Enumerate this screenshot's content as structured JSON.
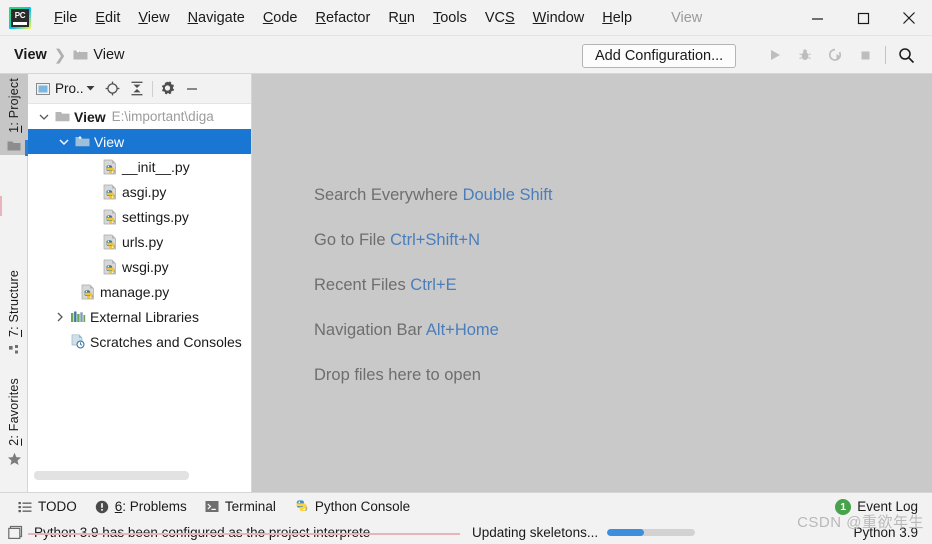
{
  "window": {
    "title": "View",
    "logo_text": "PC",
    "controls": [
      {
        "name": "minimize",
        "label": "—"
      },
      {
        "name": "maximize",
        "label": "□"
      },
      {
        "name": "close",
        "label": "✕"
      }
    ]
  },
  "menubar": {
    "items": [
      {
        "label": "File",
        "mnemonic": "F"
      },
      {
        "label": "Edit",
        "mnemonic": "E"
      },
      {
        "label": "View",
        "mnemonic": "V"
      },
      {
        "label": "Navigate",
        "mnemonic": "N"
      },
      {
        "label": "Code",
        "mnemonic": "C"
      },
      {
        "label": "Refactor",
        "mnemonic": "R"
      },
      {
        "label": "Run",
        "mnemonic": "u"
      },
      {
        "label": "Tools",
        "mnemonic": "T"
      },
      {
        "label": "VCS",
        "mnemonic": "S"
      },
      {
        "label": "Window",
        "mnemonic": "W"
      },
      {
        "label": "Help",
        "mnemonic": "H"
      }
    ]
  },
  "navbar": {
    "breadcrumb_root": "View",
    "breadcrumb_separator": "❯",
    "breadcrumb_leaf": "View",
    "folder_icon": "folder-icon",
    "add_configuration_label": "Add Configuration...",
    "toolbar_icons": [
      {
        "name": "run-icon",
        "enabled": false
      },
      {
        "name": "debug-icon",
        "enabled": false
      },
      {
        "name": "run-with-coverage-icon",
        "enabled": false
      },
      {
        "name": "stop-icon",
        "enabled": false
      },
      {
        "name": "search-icon",
        "enabled": true
      }
    ]
  },
  "left_strip": {
    "tabs": [
      {
        "label": "1: Project",
        "mnemonic": "1",
        "icon": "folder-icon",
        "active": true
      },
      {
        "label": "7: Structure",
        "mnemonic": "7",
        "icon": "structure-icon",
        "active": false
      },
      {
        "label": "2: Favorites",
        "mnemonic": "2",
        "icon": "star-icon",
        "active": false
      }
    ]
  },
  "project_panel": {
    "title": "Pro..",
    "tools": [
      {
        "name": "select-opened-file-icon"
      },
      {
        "name": "collapse-all-icon"
      },
      {
        "name": "settings-gear-icon"
      },
      {
        "name": "hide-panel-icon"
      }
    ],
    "tree": [
      {
        "label": "View",
        "path": "E:\\important\\diga",
        "icon": "module-folder-icon",
        "indent": 0,
        "twisty": "expanded",
        "bold": true,
        "selected": false
      },
      {
        "label": "View",
        "path": "",
        "icon": "source-folder-icon",
        "indent": 1,
        "twisty": "expanded",
        "bold": false,
        "selected": true
      },
      {
        "label": "__init__.py",
        "path": "",
        "icon": "python-file-icon",
        "indent": 3,
        "twisty": "none",
        "bold": false,
        "selected": false
      },
      {
        "label": "asgi.py",
        "path": "",
        "icon": "python-file-icon",
        "indent": 3,
        "twisty": "none",
        "bold": false,
        "selected": false
      },
      {
        "label": "settings.py",
        "path": "",
        "icon": "python-file-icon",
        "indent": 3,
        "twisty": "none",
        "bold": false,
        "selected": false
      },
      {
        "label": "urls.py",
        "path": "",
        "icon": "python-file-icon",
        "indent": 3,
        "twisty": "none",
        "bold": false,
        "selected": false
      },
      {
        "label": "wsgi.py",
        "path": "",
        "icon": "python-file-icon",
        "indent": 3,
        "twisty": "none",
        "bold": false,
        "selected": false
      },
      {
        "label": "manage.py",
        "path": "",
        "icon": "python-file-icon",
        "indent": 2,
        "twisty": "none",
        "bold": false,
        "selected": false
      },
      {
        "label": "External Libraries",
        "path": "",
        "icon": "libraries-icon",
        "indent": 1,
        "twisty": "collapsed",
        "bold": false,
        "selected": false
      },
      {
        "label": "Scratches and Consoles",
        "path": "",
        "icon": "scratches-icon",
        "indent": 1,
        "twisty": "none",
        "bold": false,
        "selected": false
      }
    ]
  },
  "editor": {
    "hints": [
      {
        "label": "Search Everywhere",
        "key": "Double Shift"
      },
      {
        "label": "Go to File",
        "key": "Ctrl+Shift+N"
      },
      {
        "label": "Recent Files",
        "key": "Ctrl+E"
      },
      {
        "label": "Navigation Bar",
        "key": "Alt+Home"
      },
      {
        "label": "Drop files here to open",
        "key": ""
      }
    ]
  },
  "bottom_bar": {
    "tabs": [
      {
        "label": "TODO",
        "icon": "todo-list-icon",
        "mnemonic": ""
      },
      {
        "label": "6: Problems",
        "icon": "problems-icon",
        "mnemonic": "6"
      },
      {
        "label": "Terminal",
        "icon": "terminal-icon",
        "mnemonic": ""
      },
      {
        "label": "Python Console",
        "icon": "python-console-icon",
        "mnemonic": ""
      }
    ],
    "event_log": {
      "label": "Event Log",
      "count": "1",
      "badge_color": "#47a34a"
    }
  },
  "status_bar": {
    "message": "Python 3.9 has been configured as the project interprete",
    "progress_label": "Updating skeletons...",
    "progress_percent": 42,
    "interpreter": "Python 3.9",
    "toggle_icon": "show-tool-windows-icon"
  },
  "watermark": "CSDN @重欲年生",
  "colors": {
    "selection_blue": "#1976d2",
    "hint_key_blue": "#4a7ebb",
    "editor_background": "#c9c9c9",
    "chrome_background": "#f2f2f2",
    "progress_blue": "#3d8fdd"
  }
}
